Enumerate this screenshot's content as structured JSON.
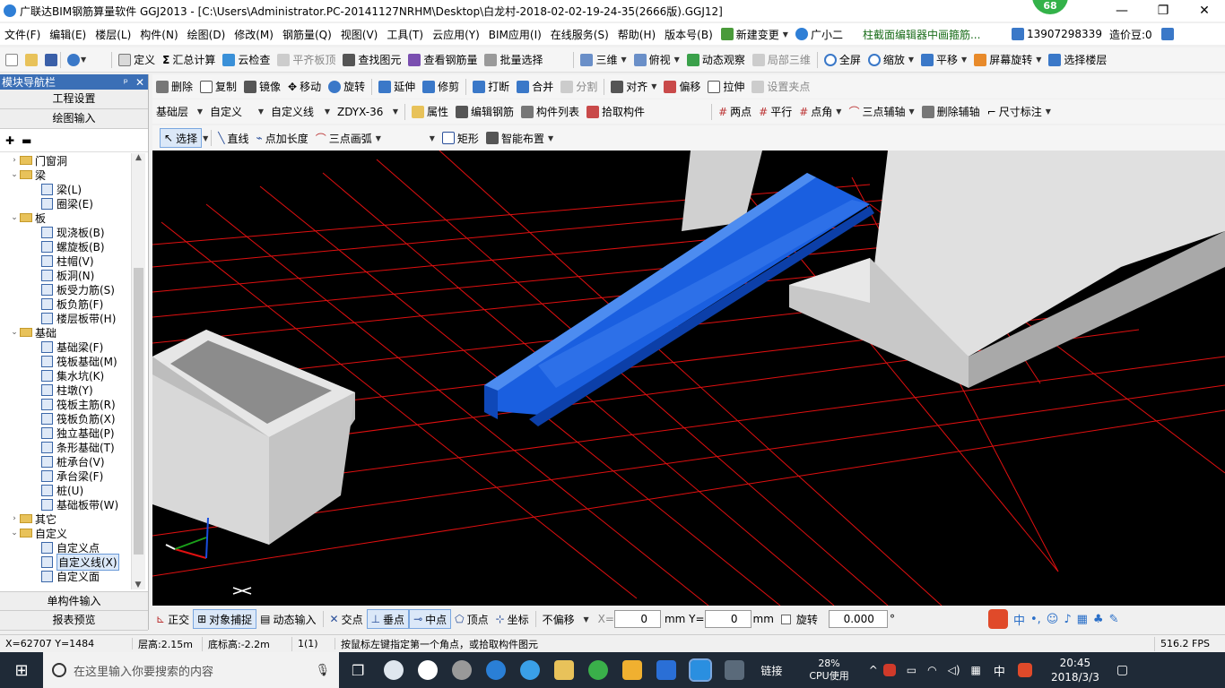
{
  "window": {
    "title": "广联达BIM钢筋算量软件 GGJ2013 - [C:\\Users\\Administrator.PC-20141127NRHM\\Desktop\\白龙村-2018-02-02-19-24-35(2666版).GGJ12]",
    "badge": "68",
    "min": "—",
    "max": "❐",
    "close": "✕"
  },
  "menu": {
    "items": [
      "文件(F)",
      "编辑(E)",
      "楼层(L)",
      "构件(N)",
      "绘图(D)",
      "修改(M)",
      "钢筋量(Q)",
      "视图(V)",
      "工具(T)",
      "云应用(Y)",
      "BIM应用(I)",
      "在线服务(S)",
      "帮助(H)",
      "版本号(B)"
    ],
    "new_change": "新建变更",
    "guangxiaoer": "广小二",
    "marquee": "柱截面编辑器中画箍筋...",
    "phone": "13907298339",
    "zaojia": "造价豆:0"
  },
  "toolbar1": {
    "items": [
      "定义",
      "汇总计算",
      "云检查",
      "平齐板顶",
      "查找图元",
      "查看钢筋量",
      "批量选择",
      "三维",
      "俯视",
      "动态观察",
      "局部三维",
      "全屏",
      "缩放",
      "平移",
      "屏幕旋转",
      "选择楼层"
    ]
  },
  "toolbar2": {
    "items": [
      "删除",
      "复制",
      "镜像",
      "移动",
      "旋转",
      "延伸",
      "修剪",
      "打断",
      "合并",
      "分割",
      "对齐",
      "偏移",
      "拉伸",
      "设置夹点"
    ]
  },
  "toolbar3": {
    "floor": "基础层",
    "category": "自定义",
    "type": "自定义线",
    "name": "ZDYX-36",
    "items": [
      "属性",
      "编辑钢筋",
      "构件列表",
      "拾取构件"
    ],
    "axis_items": [
      "两点",
      "平行",
      "点角",
      "三点辅轴",
      "删除辅轴",
      "尺寸标注"
    ]
  },
  "toolbar4": {
    "items": [
      "选择",
      "直线",
      "点加长度",
      "三点画弧",
      "矩形",
      "智能布置"
    ]
  },
  "nav": {
    "header": "模块导航栏",
    "pin": "ᵖ",
    "close": "✕",
    "btn_project": "工程设置",
    "btn_draw": "绘图输入",
    "tree": [
      {
        "label": "门窗洞",
        "level": 0,
        "toggle": ">"
      },
      {
        "label": "梁",
        "level": 0,
        "toggle": "v"
      },
      {
        "label": "梁(L)",
        "level": 1
      },
      {
        "label": "圈梁(E)",
        "level": 1
      },
      {
        "label": "板",
        "level": 0,
        "toggle": "v"
      },
      {
        "label": "现浇板(B)",
        "level": 1
      },
      {
        "label": "螺旋板(B)",
        "level": 1
      },
      {
        "label": "柱帽(V)",
        "level": 1
      },
      {
        "label": "板洞(N)",
        "level": 1
      },
      {
        "label": "板受力筋(S)",
        "level": 1
      },
      {
        "label": "板负筋(F)",
        "level": 1
      },
      {
        "label": "楼层板带(H)",
        "level": 1
      },
      {
        "label": "基础",
        "level": 0,
        "toggle": "v"
      },
      {
        "label": "基础梁(F)",
        "level": 1
      },
      {
        "label": "筏板基础(M)",
        "level": 1
      },
      {
        "label": "集水坑(K)",
        "level": 1
      },
      {
        "label": "柱墩(Y)",
        "level": 1
      },
      {
        "label": "筏板主筋(R)",
        "level": 1
      },
      {
        "label": "筏板负筋(X)",
        "level": 1
      },
      {
        "label": "独立基础(P)",
        "level": 1
      },
      {
        "label": "条形基础(T)",
        "level": 1
      },
      {
        "label": "桩承台(V)",
        "level": 1
      },
      {
        "label": "承台梁(F)",
        "level": 1
      },
      {
        "label": "桩(U)",
        "level": 1
      },
      {
        "label": "基础板带(W)",
        "level": 1
      },
      {
        "label": "其它",
        "level": 0,
        "toggle": ">"
      },
      {
        "label": "自定义",
        "level": 0,
        "toggle": "v"
      },
      {
        "label": "自定义点",
        "level": 1
      },
      {
        "label": "自定义线(X)",
        "level": 1,
        "selected": true
      },
      {
        "label": "自定义面",
        "level": 1
      }
    ],
    "btn_single": "单构件输入",
    "btn_report": "报表预览"
  },
  "snapbar": {
    "items": [
      "正交",
      "对象捕捉",
      "动态输入",
      "交点",
      "垂点",
      "中点",
      "顶点",
      "坐标"
    ],
    "offset_mode": "不偏移",
    "x_label": "X=",
    "x_value": "0",
    "y_label": "mm Y=",
    "y_value": "0",
    "unit": "mm",
    "rotate_label": "旋转",
    "rotate_value": "0.000",
    "deg": "°"
  },
  "statusbar": {
    "coords": "X=62707 Y=1484",
    "floor_height": "层高:2.15m",
    "bottom_elev": "底标高:-2.2m",
    "count": "1(1)",
    "hint": "按鼠标左键指定第一个角点，或拾取构件图元",
    "fps": "516.2 FPS"
  },
  "taskbar": {
    "search_placeholder": "在这里输入你要搜索的内容",
    "link": "链接",
    "cpu_pct": "28%",
    "cpu_label": "CPU使用",
    "ime": "中",
    "time": "20:45",
    "date": "2018/3/3"
  },
  "colors": {
    "beam_blue": "#1a5fe0",
    "grid_red": "#e01010",
    "concrete": "#dcdcdc"
  }
}
